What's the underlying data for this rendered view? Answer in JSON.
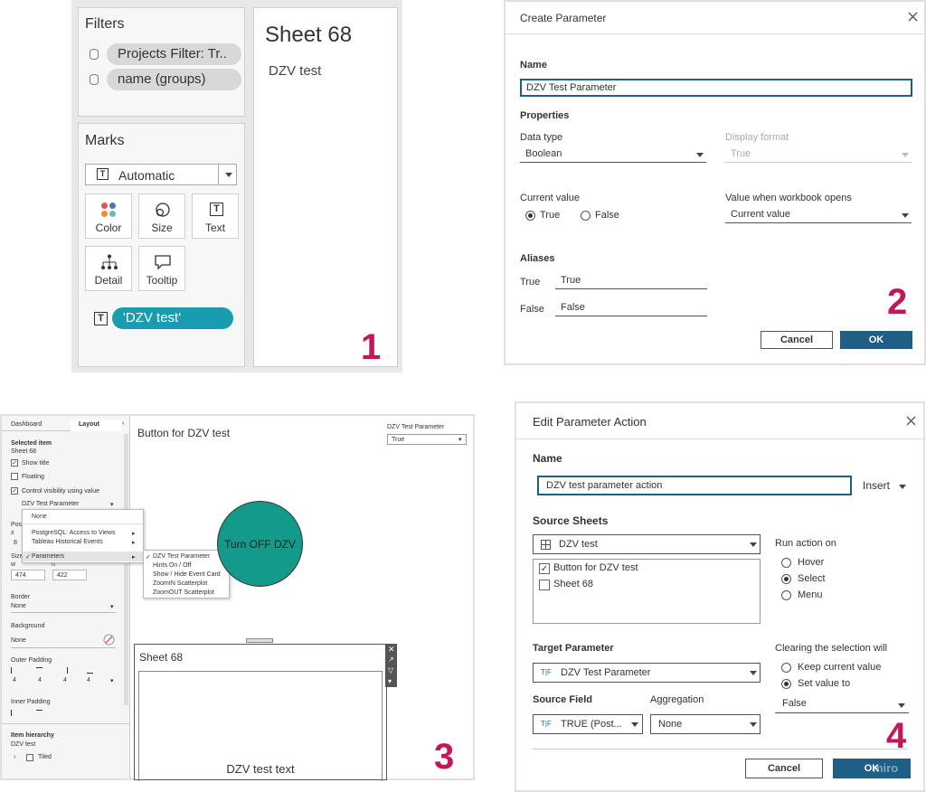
{
  "panel1": {
    "filters_title": "Filters",
    "filters": [
      "Projects Filter: Tr..",
      "name (groups)"
    ],
    "marks_title": "Marks",
    "mark_type": "Automatic",
    "mark_buttons": [
      "Color",
      "Size",
      "Text",
      "Detail",
      "Tooltip"
    ],
    "text_pill": "'DZV test'",
    "sheet_title": "Sheet 68",
    "sheet_text": "DZV test",
    "step": "1"
  },
  "panel2": {
    "title": "Create Parameter",
    "name_label": "Name",
    "name_value": "DZV Test Parameter",
    "properties_label": "Properties",
    "data_type_label": "Data type",
    "data_type_value": "Boolean",
    "display_format_label": "Display format",
    "display_format_value": "True",
    "current_value_label": "Current value",
    "radio_true": "True",
    "radio_false": "False",
    "workbook_opens_label": "Value when workbook opens",
    "workbook_opens_value": "Current value",
    "aliases_label": "Aliases",
    "alias_true_label": "True",
    "alias_true_value": "True",
    "alias_false_label": "False",
    "alias_false_value": "False",
    "cancel": "Cancel",
    "ok": "OK",
    "step": "2"
  },
  "panel3": {
    "tab_dashboard": "Dashboard",
    "tab_layout": "Layout",
    "selected_item_label": "Selected item",
    "selected_item_value": "Sheet 68",
    "show_title": "Show title",
    "floating": "Floating",
    "control_visibility": "Control visibility using value",
    "param_dropdown": "DZV Test Parameter",
    "pos_label": "Posi",
    "x_label": "x",
    "x_value": "8",
    "size_label": "Size",
    "w_label": "w",
    "h_label": "h",
    "w_value": "474",
    "h_value": "422",
    "border_label": "Border",
    "border_value": "None",
    "background_label": "Background",
    "background_value": "None",
    "outer_padding_label": "Outer Padding",
    "padding_values": [
      "4",
      "4",
      "4",
      "4"
    ],
    "inner_padding_label": "Inner Padding",
    "item_hierarchy_label": "Item hierarchy",
    "item_hierarchy_root": "DZV test",
    "item_hierarchy_child": "Tiled",
    "menu1": [
      "None",
      "PostgreSQL: Access to Views",
      "Tableau Historical Events",
      "Parameters"
    ],
    "menu2": [
      "DZV Test Parameter",
      "Hints On / Off",
      "Show / Hide Event Card",
      "ZoomIN Scatterplot",
      "ZoomOUT Scatterplot"
    ],
    "canvas_title": "Button for DZV test",
    "param_ctrl_label": "DZV Test Parameter",
    "param_ctrl_value": "True",
    "circle_text": "Turn OFF DZV",
    "sheet_title": "Sheet 68",
    "sheet_text": "DZV test text",
    "step": "3"
  },
  "panel4": {
    "title": "Edit Parameter Action",
    "name_label": "Name",
    "name_value": "DZV test parameter action",
    "insert": "Insert",
    "source_sheets_label": "Source Sheets",
    "source_ds": "DZV test",
    "sheets": [
      "Button for DZV test",
      "Sheet 68"
    ],
    "run_action_label": "Run action on",
    "run_options": [
      "Hover",
      "Select",
      "Menu"
    ],
    "target_param_label": "Target Parameter",
    "target_param_value": "DZV Test Parameter",
    "clearing_label": "Clearing the selection will",
    "clear_options": [
      "Keep current value",
      "Set value to"
    ],
    "set_value": "False",
    "source_field_label": "Source Field",
    "source_field_value": "TRUE (Post...",
    "aggregation_label": "Aggregation",
    "aggregation_value": "None",
    "cancel": "Cancel",
    "ok": "OK",
    "watermark": "miro",
    "step": "4"
  },
  "colors": {
    "teal": "#1a9cb0",
    "button_blue": "#1f5f86",
    "step_pink": "#c2185b",
    "circle": "#149a8a"
  }
}
